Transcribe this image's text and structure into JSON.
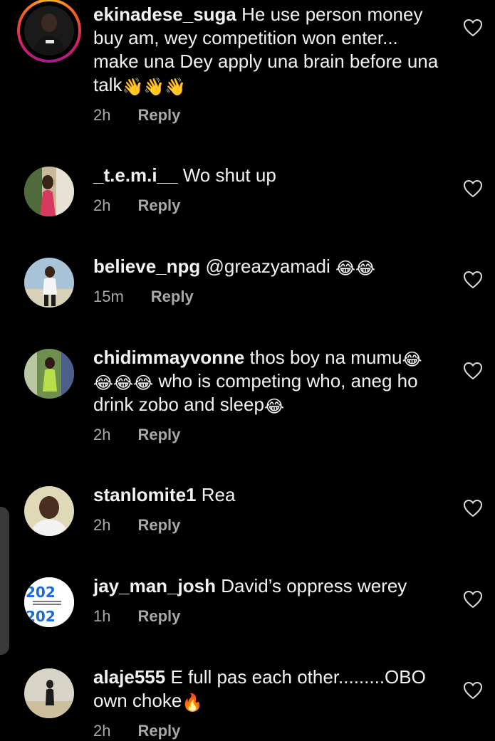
{
  "comments": [
    {
      "username": "ekinadese_suga",
      "text": " He use person money buy am, wey competition won enter... make una Dey apply una brain before una talk",
      "emoji": "👋👋👋",
      "time": "2h",
      "reply": "Reply"
    },
    {
      "username": "_t.e.m.i__",
      "text": " Wo shut up",
      "emoji": "",
      "time": "2h",
      "reply": "Reply"
    },
    {
      "username": "believe_npg",
      "text": " @greazyamadi ",
      "emoji": "😂😂",
      "time": "15m",
      "reply": "Reply"
    },
    {
      "username": "chidimmayvonne",
      "text_a": " thos boy na mumu",
      "emoji_a": "😂",
      "emoji_b": "😂😂😂",
      "text_b": " who is competing who, aneg ho drink zobo and sleep",
      "emoji_c": "😂",
      "time": "2h",
      "reply": "Reply"
    },
    {
      "username": "stanlomite1",
      "text": " Rea",
      "emoji": "",
      "time": "2h",
      "reply": "Reply"
    },
    {
      "username": "jay_man_josh",
      "text": " David’s oppress werey",
      "emoji": "",
      "time": "1h",
      "reply": "Reply"
    },
    {
      "username": "alaje555",
      "text": " E full pas each other.........OBO own choke",
      "emoji": "🔥",
      "time": "2h",
      "reply": "Reply"
    }
  ],
  "avatar_badge": {
    "year_top": "202",
    "year_bottom": "202"
  },
  "colors": {
    "background": "#000000",
    "text": "#f2f2f2",
    "meta": "#a8a8a8",
    "story_ring": "#d41872"
  },
  "icons": {
    "like": "heart-outline-icon"
  }
}
